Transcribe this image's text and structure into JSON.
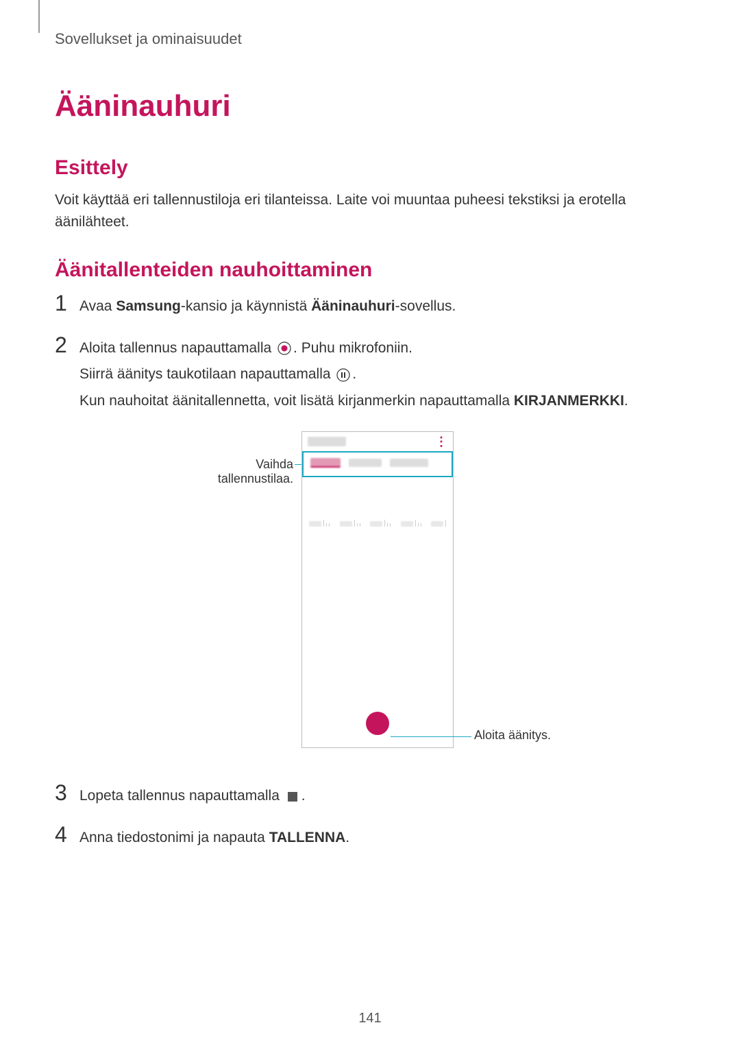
{
  "running_head": "Sovellukset ja ominaisuudet",
  "title": "Ääninauhuri",
  "section1": {
    "heading": "Esittely",
    "body": "Voit käyttää eri tallennustiloja eri tilanteissa. Laite voi muuntaa puheesi tekstiksi ja erotella äänilähteet."
  },
  "section2": {
    "heading": "Äänitallenteiden nauhoittaminen",
    "steps": {
      "s1": {
        "num": "1",
        "pre": "Avaa ",
        "bold1": "Samsung",
        "mid": "-kansio ja käynnistä ",
        "bold2": "Ääninauhuri",
        "post": "-sovellus."
      },
      "s2": {
        "num": "2",
        "line1_pre": "Aloita tallennus napauttamalla ",
        "line1_post": ". Puhu mikrofoniin.",
        "line2_pre": "Siirrä äänitys taukotilaan napauttamalla ",
        "line2_post": ".",
        "line3_pre": "Kun nauhoitat äänitallennetta, voit lisätä kirjanmerkin napauttamalla ",
        "line3_bold": "KIRJANMERKKI",
        "line3_post": "."
      },
      "s3": {
        "num": "3",
        "pre": "Lopeta tallennus napauttamalla ",
        "post": "."
      },
      "s4": {
        "num": "4",
        "pre": "Anna tiedostonimi ja napauta ",
        "bold": "TALLENNA",
        "post": "."
      }
    }
  },
  "figure": {
    "callout_left": "Vaihda tallennustilaa.",
    "callout_right": "Aloita äänitys.",
    "kebab": "⋮"
  },
  "page_number": "141"
}
